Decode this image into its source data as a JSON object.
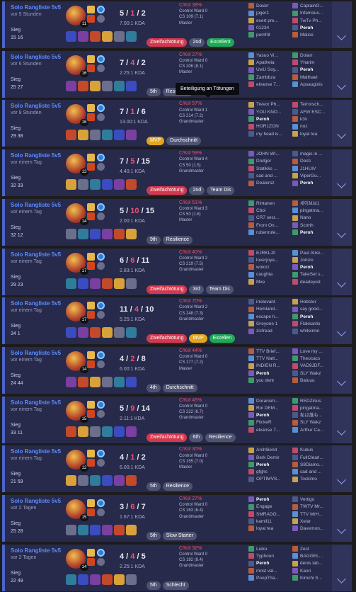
{
  "tooltip": "Beteiligung an Tötungen",
  "colors": {
    "accent": "#4a64c8",
    "kp": "#f0506e",
    "card": "#272a4a"
  },
  "matches": [
    {
      "queue": "Solo Rangliste 5v5",
      "ago": "vor 5 Stunden",
      "result": "Sieg",
      "duration": "15 16",
      "level": "11",
      "k": "5",
      "d": "1",
      "a": "2",
      "ratio": "7.00:1 KDA",
      "kp": "C/Kill 39%",
      "ward": "Control Ward 0",
      "cs": "CS 109 (7.1)",
      "rank": "Master",
      "tags": [
        {
          "label": "Zweifachtötung",
          "style": "red"
        },
        {
          "label": "2nd",
          "style": "gray"
        },
        {
          "label": "Excellent",
          "style": "green"
        }
      ],
      "team1": [
        "Doiarr",
        "jpger1",
        "exert pre...",
        "01234",
        "pomfrit"
      ],
      "team2": [
        "CaptainO...",
        "Infamous...",
        "TwTv Ph...",
        "Peroh",
        "Malice"
      ],
      "me": "team2:3"
    },
    {
      "queue": "Solo Rangliste 5v5",
      "ago": "vor 6 Stunden",
      "result": "Sieg",
      "duration": "25 27",
      "level": "16",
      "k": "7",
      "d": "4",
      "a": "2",
      "ratio": "2.25:1 KDA",
      "kp": "C/Kill 27%",
      "ward": "Control Ward 0",
      "cs": "CS 206 (8.1)",
      "rank": "Master",
      "tags": [
        {
          "label": "5th",
          "style": "gray"
        },
        {
          "label": "Resilience",
          "style": "gray"
        }
      ],
      "team1": [
        "Yasuo Vi...",
        "Apatheia",
        "UwU Soy...",
        "Zambbza",
        "elvanse 7..."
      ],
      "team2": [
        "Doiarr",
        "Yharim",
        "Peroh",
        "Malthael",
        "Apsauginis"
      ],
      "me": "team2:2"
    },
    {
      "queue": "Solo Rangliste 5v5",
      "ago": "vor 8 Stunden",
      "result": "Sieg",
      "duration": "29 38",
      "level": "16",
      "k": "7",
      "d": "1",
      "a": "6",
      "ratio": "13.00:1 KDA",
      "kp": "C/Kill 57%",
      "ward": "Control Ward 1",
      "cs": "CS 214 (7.2)",
      "rank": "Grandmaster",
      "tags": [
        {
          "label": "MVP",
          "style": "gold"
        },
        {
          "label": "Durchschnitt",
          "style": "gray"
        }
      ],
      "team1": [
        "Trevor Ph...",
        "YOU KNO...",
        "Peroh",
        "HOR1ZON",
        "my head is..."
      ],
      "team2": [
        "Terrorsch...",
        "AFW ESC...",
        "k3v",
        "noz",
        "loyal tea"
      ],
      "me": "team1:2"
    },
    {
      "queue": "Solo Rangliste 5v5",
      "ago": "vor einem Tag",
      "result": "Sieg",
      "duration": "32 33",
      "level": "13",
      "k": "7",
      "d": "5",
      "a": "15",
      "ratio": "4.40:1 KDA",
      "kp": "C/Kill 59%",
      "ward": "Control Ward 4",
      "cs": "CS 50 (1.5)",
      "rank": "Grandmaster",
      "tags": [
        {
          "label": "Zweifachtötung",
          "style": "red"
        },
        {
          "label": "2nd",
          "style": "gray"
        },
        {
          "label": "Team Dis",
          "style": "gray"
        }
      ],
      "team1": [
        "JOHN WI...",
        "Dodger",
        "Statikks ...",
        "sad and ...",
        "Dealersz"
      ],
      "team2": [
        "magic in ...",
        "Desti",
        "J1HUIV",
        "ViperGu...",
        "Peroh"
      ],
      "me": "team2:4"
    },
    {
      "queue": "Solo Rangliste 5v5",
      "ago": "vor einem Tag",
      "result": "Sieg",
      "duration": "32 12",
      "level": "14",
      "k": "5",
      "d": "10",
      "a": "15",
      "ratio": "2.00:1 KDA",
      "kp": "C/Kill 51%",
      "ward": "Control Ward 3",
      "cs": "CS 50 (1.6)",
      "rank": "Master",
      "tags": [
        {
          "label": "9th",
          "style": "gray"
        },
        {
          "label": "Resilience",
          "style": "gray"
        }
      ],
      "team1": [
        "Rintanen",
        "Cboi",
        "CR7 secr...",
        "From On...",
        "rubenrule..."
      ],
      "team2": [
        "세이브브1",
        "pingatma...",
        "Nano",
        "Scorth",
        "Peroh"
      ],
      "me": "team2:4"
    },
    {
      "queue": "Solo Rangliste 5v5",
      "ago": "vor einem Tag",
      "result": "Sieg",
      "duration": "29 23",
      "level": "17",
      "k": "6",
      "d": "6",
      "a": "11",
      "ratio": "2.83:1 KDA",
      "kp": "C/Kill 40%",
      "ward": "Control Ward 2",
      "cs": "CS 219 (7.5)",
      "rank": "Grandmaster",
      "tags": [
        {
          "label": "Zweifachtötung",
          "style": "red"
        },
        {
          "label": "3rd",
          "style": "gray"
        },
        {
          "label": "Team Dis",
          "style": "gray"
        }
      ],
      "team1": [
        "EJRKLJ0",
        "loverjoye...",
        "wolorz",
        "caughta",
        "Mxe"
      ],
      "team2": [
        "Paul Atrei...",
        "Joinze",
        "Peroh",
        "TakeSet s...",
        "deadeyed"
      ],
      "me": "team2:2"
    },
    {
      "queue": "Solo Rangliste 5v5",
      "ago": "vor einem Tag",
      "result": "Sieg",
      "duration": "34 1",
      "level": "17",
      "k": "11",
      "d": "4",
      "a": "10",
      "ratio": "5.25:1 KDA",
      "kp": "C/Kill 70%",
      "ward": "Control Ward 2",
      "cs": "CS 248 (7.3)",
      "rank": "Grandmaster",
      "tags": [
        {
          "label": "Zweifachtötung",
          "style": "red"
        },
        {
          "label": "MVP",
          "style": "gold"
        },
        {
          "label": "Excellen",
          "style": "green"
        }
      ],
      "team1": [
        "irrelevant",
        "Hemland...",
        "escape h...",
        "Greyone 1",
        "zicfread"
      ],
      "team2": [
        "Hobster",
        "say good...",
        "Peroh",
        "Flakkardo",
        "whiteinnn"
      ],
      "me": "team2:2"
    },
    {
      "queue": "Solo Rangliste 5v5",
      "ago": "vor einem Tag",
      "result": "Sieg",
      "duration": "24 44",
      "level": "14",
      "k": "4",
      "d": "2",
      "a": "8",
      "ratio": "6.00:1 KDA",
      "kp": "C/Kill 44%",
      "ward": "Control Ward 0",
      "cs": "CS 177 (7.2)",
      "rank": "Master",
      "tags": [
        {
          "label": "4th",
          "style": "gray"
        },
        {
          "label": "Durchschnitt",
          "style": "gray"
        }
      ],
      "team1": [
        "TTV Brief...",
        "TTV Natt...",
        "INDIEN R...",
        "Peroh",
        "you dent"
      ],
      "team2": [
        "Love my ...",
        "Theocacs",
        "VAD9JDF...",
        "SLY Wakz",
        "Batuuu"
      ],
      "me": "team1:3"
    },
    {
      "queue": "Solo Rangliste 5v5",
      "ago": "vor einem Tag",
      "result": "Sieg",
      "duration": "33 11",
      "level": "15",
      "k": "5",
      "d": "9",
      "a": "14",
      "ratio": "2.11:1 KDA",
      "kp": "C/Kill 45%",
      "ward": "Control Ward 0",
      "cs": "CS 222 (6.7)",
      "rank": "Grandmaster",
      "tags": [
        {
          "label": "Zweifachtötung",
          "style": "red"
        },
        {
          "label": "6th",
          "style": "gray"
        },
        {
          "label": "Resilience",
          "style": "gray"
        }
      ],
      "team1": [
        "Doransm...",
        "Roi DEM...",
        "Peroh",
        "FlickeR",
        "elvanse 7..."
      ],
      "team2": [
        "REDZirius",
        "pingatma...",
        "私は誰も...",
        "SLY Wakz",
        "Arthur Ca..."
      ],
      "me": "team1:2"
    },
    {
      "queue": "Solo Rangliste 5v5",
      "ago": "vor einem Tag",
      "result": "Sieg",
      "duration": "21 59",
      "level": "12",
      "k": "4",
      "d": "1",
      "a": "2",
      "ratio": "6.00:1 KDA",
      "kp": "C/Kill 30%",
      "ward": "Control Ward 0",
      "cs": "CS 155 (7.0)",
      "rank": "Master",
      "tags": [
        {
          "label": "5th",
          "style": "gray"
        },
        {
          "label": "Resilience",
          "style": "gray"
        }
      ],
      "team1": [
        "Arch9iend",
        "Berk Demir",
        "Peroh",
        "gfghs",
        "OPTIMVS..."
      ],
      "team2": [
        "Kubuś",
        "FullClearl...",
        "S8Diamo...",
        "sad and ...",
        "Tockimo"
      ],
      "me": "team1:2"
    },
    {
      "queue": "Solo Rangliste 5v5",
      "ago": "vor 2 Tagen",
      "result": "Sieg",
      "duration": "25 28",
      "level": "15",
      "k": "3",
      "d": "6",
      "a": "7",
      "ratio": "1.67:1 KDA",
      "kp": "C/Kill 27%",
      "ward": "Control Ward 0",
      "cs": "CS 163 (6.4)",
      "rank": "Grandmaster",
      "tags": [
        {
          "label": "5th",
          "style": "gray"
        },
        {
          "label": "Slow Starter",
          "style": "gray"
        }
      ],
      "team1": [
        "Peroh",
        "Engage",
        "SMRADO...",
        "kamil11",
        "loyal tea"
      ],
      "team2": [
        "Vertigo",
        "TWTV Mr...",
        "TTV MrH...",
        "Xelar",
        "Davemon..."
      ],
      "me": "team1:0"
    },
    {
      "queue": "Solo Rangliste 5v5",
      "ago": "vor 2 Tagen",
      "result": "Sieg",
      "duration": "22 49",
      "level": "14",
      "k": "4",
      "d": "4",
      "a": "5",
      "ratio": "2.25:1 KDA",
      "kp": "C/Kill 32%",
      "ward": "Control Ward 0",
      "cs": "CS 192 (8.4)",
      "rank": "Grandmaster",
      "tags": [
        {
          "label": "5th",
          "style": "gray"
        },
        {
          "label": "Schlecht",
          "style": "gray"
        }
      ],
      "team1": [
        "Luiku",
        "Typhoon",
        "Peroh",
        "most val...",
        "PoopTha..."
      ],
      "team2": [
        "Zest",
        "BAGGEL...",
        "denis lab...",
        "Kaori",
        "Kimchi S..."
      ],
      "me": "team1:2"
    }
  ]
}
